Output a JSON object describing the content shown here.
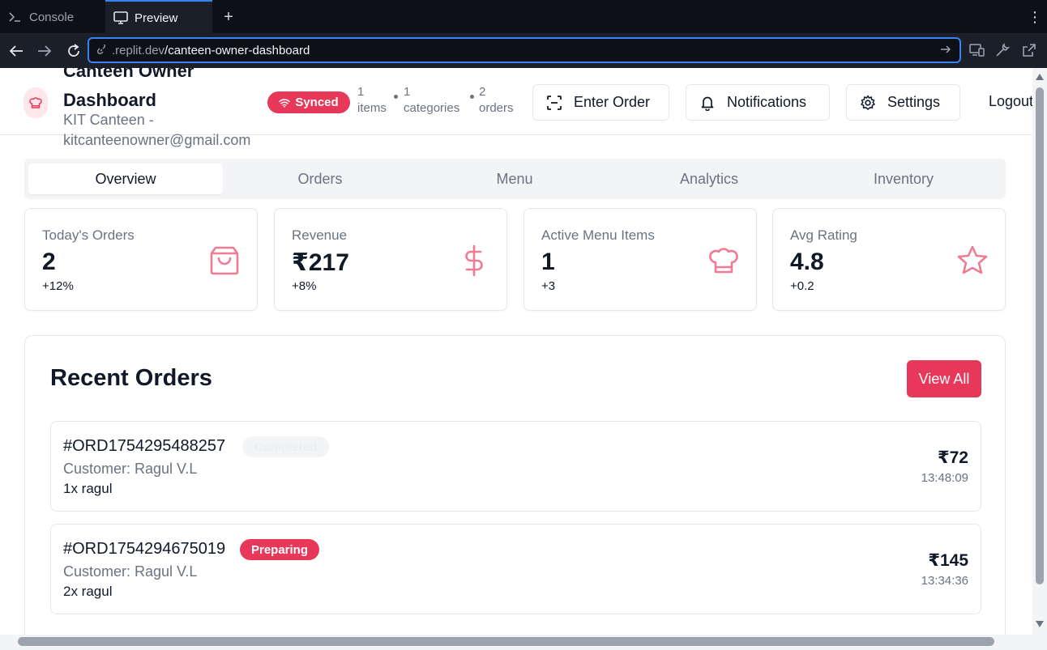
{
  "browser": {
    "tabs": [
      {
        "label": "Console",
        "active": false
      },
      {
        "label": "Preview",
        "active": true
      }
    ],
    "url_host": ".replit.dev",
    "url_path": "/canteen-owner-dashboard"
  },
  "header": {
    "title": "Canteen Owner Dashboard",
    "subtitle": "KIT Canteen - kitcanteenowner@gmail.com",
    "sync_status": "Synced",
    "stats": {
      "items_count": "1",
      "items_label": "items",
      "categories_count": "1",
      "categories_label": "categories",
      "orders_count": "2",
      "orders_label": "orders"
    },
    "buttons": {
      "enter_order": "Enter Order",
      "notifications": "Notifications",
      "settings": "Settings",
      "logout": "Logout"
    }
  },
  "tabs": [
    "Overview",
    "Orders",
    "Menu",
    "Analytics",
    "Inventory"
  ],
  "active_tab": "Overview",
  "stat_cards": [
    {
      "label": "Today's Orders",
      "value": "2",
      "delta": "+12%",
      "icon": "shopping-bag-icon"
    },
    {
      "label": "Revenue",
      "value": "₹217",
      "delta": "+8%",
      "icon": "dollar-icon"
    },
    {
      "label": "Active Menu Items",
      "value": "1",
      "delta": "+3",
      "icon": "chef-hat-icon"
    },
    {
      "label": "Avg Rating",
      "value": "4.8",
      "delta": "+0.2",
      "icon": "star-icon"
    }
  ],
  "recent_orders": {
    "title": "Recent Orders",
    "view_all": "View All",
    "orders": [
      {
        "id": "#ORD1754295488257",
        "status": "Completed",
        "customer": "Customer: Ragul V.L",
        "items": "1x ragul",
        "amount": "₹72",
        "time": "13:48:09"
      },
      {
        "id": "#ORD1754294675019",
        "status": "Preparing",
        "customer": "Customer: Ragul V.L",
        "items": "2x ragul",
        "amount": "₹145",
        "time": "13:34:36"
      }
    ]
  },
  "colors": {
    "accent": "#e8385a",
    "icon_pink": "#f07b93",
    "muted_text": "#6b7280",
    "chrome_bg": "#1b1f2a",
    "url_focus": "#3b82f6"
  }
}
